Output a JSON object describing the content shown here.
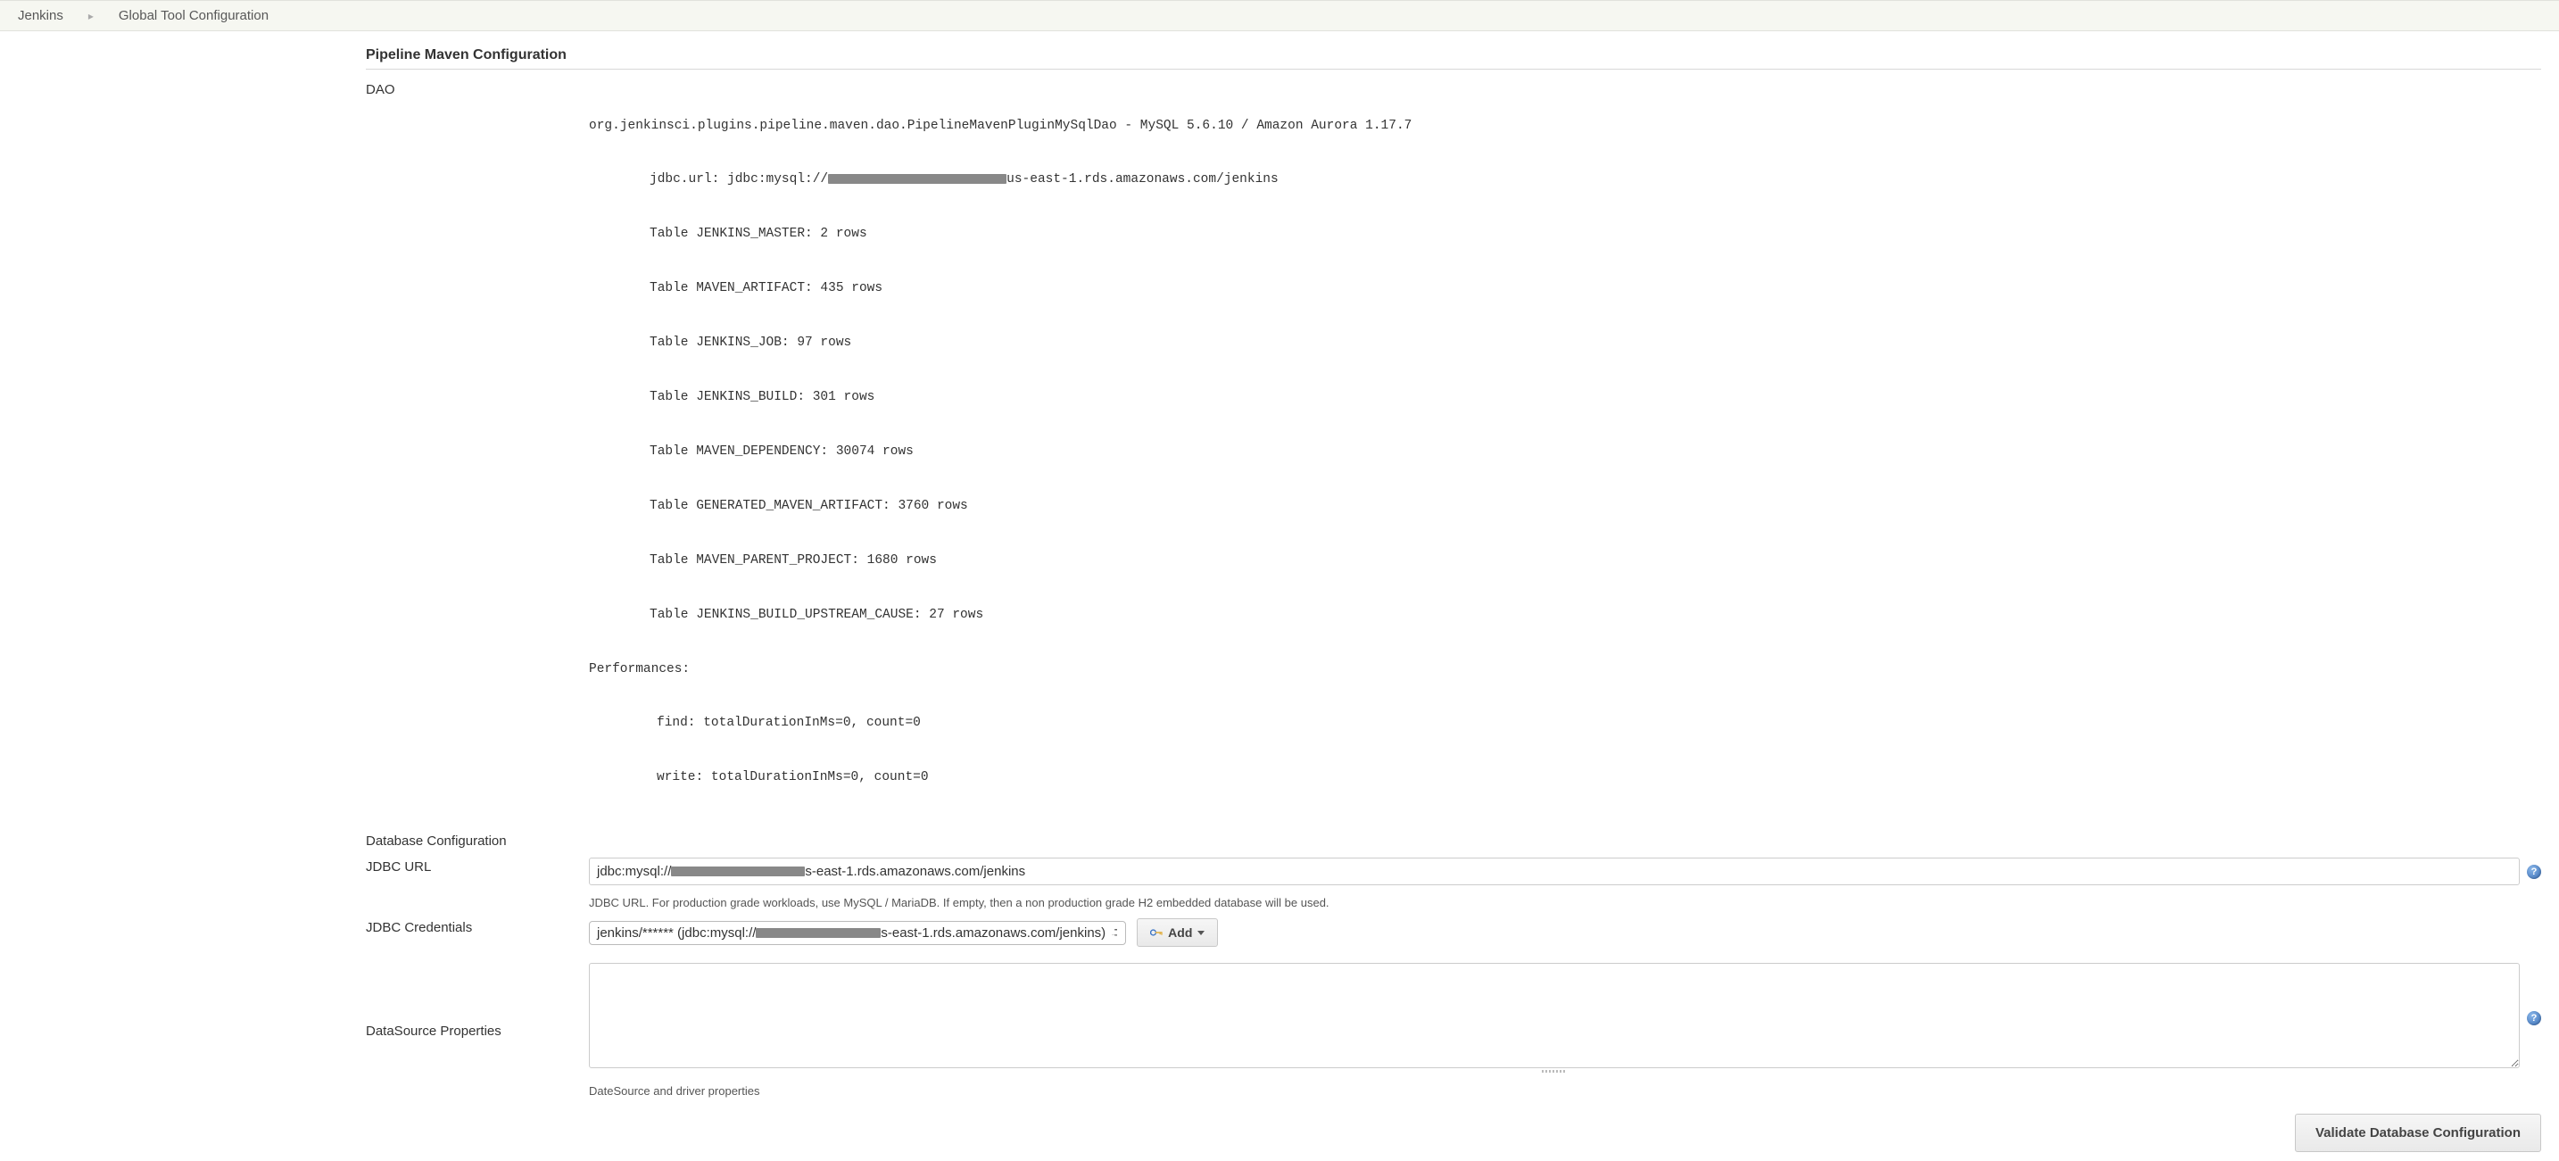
{
  "breadcrumb": {
    "root": "Jenkins",
    "current": "Global Tool Configuration"
  },
  "section": {
    "title": "Pipeline Maven Configuration"
  },
  "dao": {
    "label": "DAO",
    "header_prefix": "org.jenkinsci.plugins.pipeline.maven.dao.PipelineMavenPluginMySqlDao - MySQL 5.6.10 / Amazon Aurora 1.17.7",
    "jdbc_url_prefix": "jdbc.url: jdbc:mysql://",
    "jdbc_url_suffix": "us-east-1.rds.amazonaws.com/jenkins",
    "tables": [
      "Table JENKINS_MASTER: 2 rows",
      "Table MAVEN_ARTIFACT: 435 rows",
      "Table JENKINS_JOB: 97 rows",
      "Table JENKINS_BUILD: 301 rows",
      "Table MAVEN_DEPENDENCY: 30074 rows",
      "Table GENERATED_MAVEN_ARTIFACT: 3760 rows",
      "Table MAVEN_PARENT_PROJECT: 1680 rows",
      "Table JENKINS_BUILD_UPSTREAM_CAUSE: 27 rows"
    ],
    "perf_header": "Performances:",
    "perf_find": "find: totalDurationInMs=0, count=0",
    "perf_write": "write: totalDurationInMs=0, count=0"
  },
  "db_config": {
    "label": "Database Configuration"
  },
  "jdbc_url": {
    "label": "JDBC URL",
    "value_prefix": "jdbc:mysql://",
    "value_suffix": "s-east-1.rds.amazonaws.com/jenkins",
    "help": "JDBC URL. For production grade workloads, use MySQL / MariaDB. If empty, then a non production grade H2 embedded database will be used."
  },
  "jdbc_credentials": {
    "label": "JDBC Credentials",
    "selected_prefix": "jenkins/****** (jdbc:mysql://",
    "selected_suffix": "s-east-1.rds.amazonaws.com/jenkins)",
    "add_label": "Add"
  },
  "datasource_props": {
    "label": "DataSource Properties",
    "value": "",
    "help": "DateSource and driver properties"
  },
  "validate_button": "Validate Database Configuration",
  "help_glyph": "?"
}
